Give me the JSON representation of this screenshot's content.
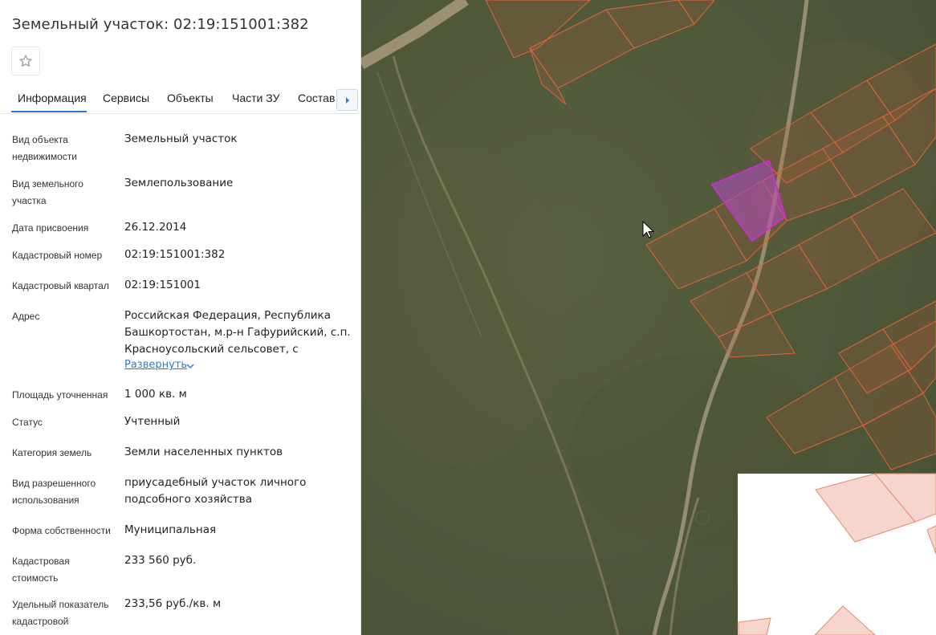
{
  "panel": {
    "title": "Земельный участок: 02:19:151001:382",
    "favorite_icon": "star-icon",
    "tabs": [
      "Информация",
      "Сервисы",
      "Объекты",
      "Части ЗУ",
      "Состав"
    ],
    "tab_scroll_icon": "caret-right-icon",
    "fields": [
      {
        "label": "Вид объекта недвижимости",
        "value": "Земельный участок"
      },
      {
        "label": "Вид земельного участка",
        "value": "Землепользование"
      },
      {
        "label": "Дата присвоения",
        "value": "26.12.2014"
      },
      {
        "label": "Кадастровый номер",
        "value": "02:19:151001:382"
      },
      {
        "label": "Кадастровый квартал",
        "value": "02:19:151001"
      },
      {
        "label": "Адрес",
        "value": "Российская Федерация, Республика Башкортостан, м.р-н Гафурийский, с.п. Красноусольский сельсовет, с"
      },
      {
        "label": "Площадь уточненная",
        "value": "1 000 кв. м"
      },
      {
        "label": "Статус",
        "value": "Учтенный"
      },
      {
        "label": "Категория земель",
        "value": "Земли населенных пунктов"
      },
      {
        "label": "Вид разрешенного использования",
        "value": "приусадебный участок личного подсобного хозяйства"
      },
      {
        "label": "Форма собственности",
        "value": "Муниципальная"
      },
      {
        "label": "Кадастровая стоимость",
        "value": "233 560 руб."
      },
      {
        "label": "Удельный показатель кадастровой",
        "value": "233,56 руб./кв. м"
      }
    ],
    "expand_label": "Развернуть"
  },
  "map": {
    "background_color": "#4f5a3c",
    "parcel_stroke": "#e0643a",
    "selected_stroke": "#c532c8",
    "selected_fill": "#b64ac2"
  }
}
